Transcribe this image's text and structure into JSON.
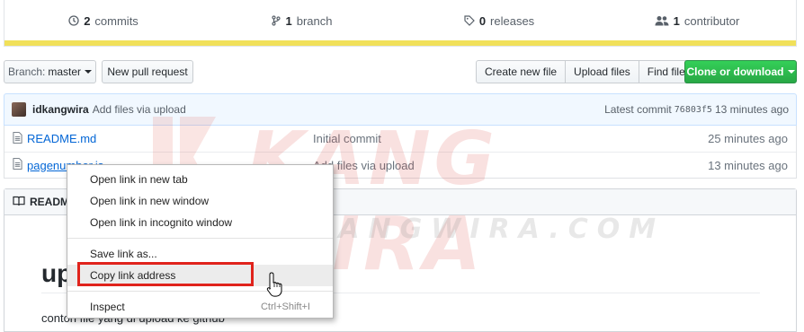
{
  "summary": {
    "commits": {
      "count": "2",
      "label": "commits"
    },
    "branches": {
      "count": "1",
      "label": "branch"
    },
    "releases": {
      "count": "0",
      "label": "releases"
    },
    "contributors": {
      "count": "1",
      "label": "contributor"
    },
    "language_color": "#f1e05a"
  },
  "toolbar": {
    "branch_label": "Branch:",
    "branch_value": "master",
    "new_pr": "New pull request",
    "create_file": "Create new file",
    "upload_files": "Upload files",
    "find_file": "Find file",
    "clone": "Clone or download"
  },
  "commit": {
    "author": "idkangwira",
    "message": "Add files via upload",
    "latest_label": "Latest commit",
    "sha": "76803f5",
    "age": "13 minutes ago"
  },
  "files": [
    {
      "name": "README.md",
      "message": "Initial commit",
      "age": "25 minutes ago"
    },
    {
      "name": "pagenumber.js",
      "message": "Add files via upload",
      "age": "13 minutes ago"
    }
  ],
  "readme": {
    "header": "README",
    "title": "up",
    "paragraph": "contoh file yang di upload ke github"
  },
  "context_menu": {
    "items": [
      {
        "label": "Open link in new tab"
      },
      {
        "label": "Open link in new window"
      },
      {
        "label": "Open link in incognito window"
      },
      {
        "label": "Save link as..."
      },
      {
        "label": "Copy link address"
      },
      {
        "label": "Inspect",
        "shortcut": "Ctrl+Shift+I"
      }
    ],
    "highlight_color": "#e0231c"
  },
  "watermark": {
    "brand": "KANG WIRA",
    "url": "WWW.KANGWIRA.COM"
  }
}
